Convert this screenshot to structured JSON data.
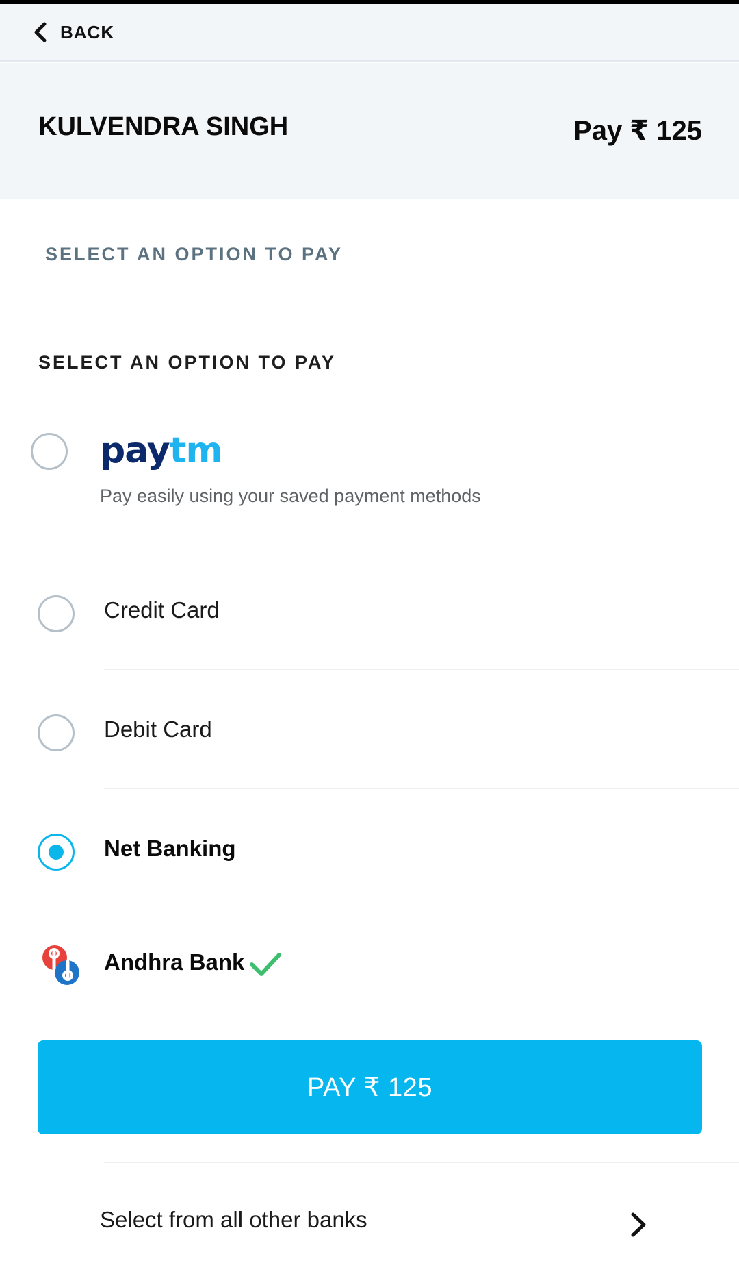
{
  "nav": {
    "back_label": "BACK",
    "back_icon": "chevron-left-icon"
  },
  "header": {
    "merchant_name": "KULVENDRA SINGH",
    "pay_label": "Pay ₹ 125"
  },
  "subheadings": {
    "primary": "SELECT AN OPTION TO PAY",
    "secondary": "SELECT AN OPTION TO PAY"
  },
  "payment_options": {
    "paytm": {
      "logo_pay": "pay",
      "logo_tm": "tm",
      "description": "Pay easily using your saved payment methods",
      "selected": false
    },
    "credit_card": {
      "label": "Credit Card",
      "selected": false
    },
    "debit_card": {
      "label": "Debit Card",
      "selected": false
    },
    "net_banking": {
      "label": "Net Banking",
      "selected": true
    }
  },
  "bank": {
    "name": "Andhra Bank",
    "logo": "andhra-bank-logo",
    "status_icon": "checkmark-icon"
  },
  "pay_button": {
    "label": "PAY ₹ 125"
  },
  "other_banks": {
    "label": "Select from all other banks",
    "icon": "chevron-right-icon"
  },
  "colors": {
    "accent": "#06b7ef",
    "radio_border": "#b5c0c9",
    "header_bg": "#f3f6f8",
    "check_green": "#3cc06f",
    "paytm_navy": "#0c2a6b",
    "paytm_cyan": "#1fb4ef"
  }
}
